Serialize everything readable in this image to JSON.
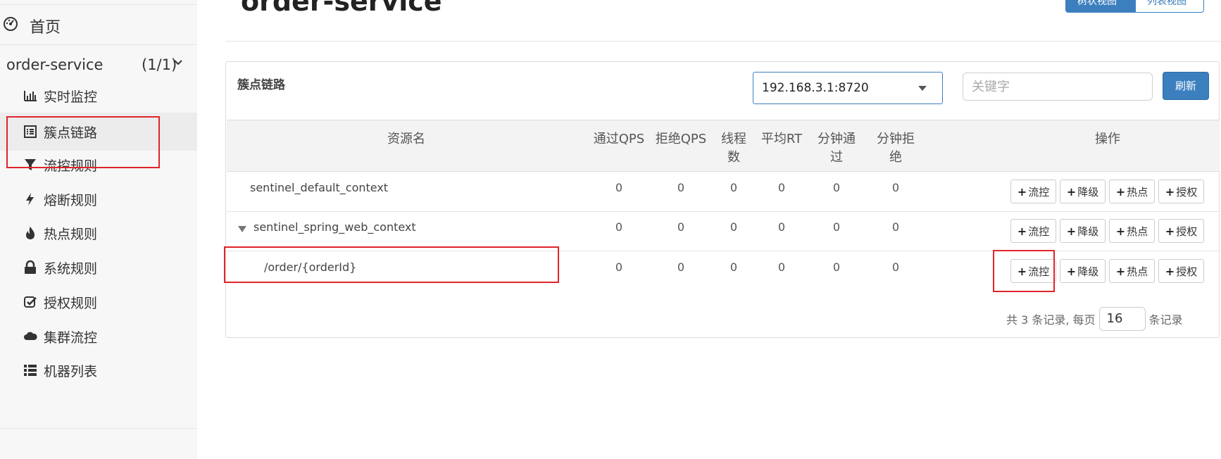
{
  "header": {
    "title": "order-service",
    "view_toggle": {
      "active": "树状视图",
      "inactive": "列表视图"
    }
  },
  "sidebar": {
    "home": "首页",
    "app": {
      "name": "order-service",
      "count": "(1/1)"
    },
    "items": [
      {
        "label": "实时监控",
        "icon": "bar-chart-icon"
      },
      {
        "label": "簇点链路",
        "icon": "list-alt-icon"
      },
      {
        "label": "流控规则",
        "icon": "filter-icon"
      },
      {
        "label": "熔断规则",
        "icon": "flash-icon"
      },
      {
        "label": "热点规则",
        "icon": "fire-icon"
      },
      {
        "label": "系统规则",
        "icon": "lock-icon"
      },
      {
        "label": "授权规则",
        "icon": "check-icon"
      },
      {
        "label": "集群流控",
        "icon": "cloud-icon"
      },
      {
        "label": "机器列表",
        "icon": "th-list-icon"
      }
    ]
  },
  "panel": {
    "title": "簇点链路",
    "machine": "192.168.3.1:8720",
    "keyword_placeholder": "关键字",
    "refresh": "刷新",
    "columns": {
      "resource": "资源名",
      "pass_qps": "通过QPS",
      "block_qps": "拒绝QPS",
      "threads": "线程\n数",
      "avg_rt": "平均RT",
      "minute_pass": "分钟通\n过",
      "minute_block": "分钟拒\n绝",
      "ops": "操作"
    },
    "rows": [
      {
        "resource": "sentinel_default_context",
        "pass_qps": "0",
        "block_qps": "0",
        "threads": "0",
        "avg_rt": "0",
        "minute_pass": "0",
        "minute_block": "0"
      },
      {
        "resource": "sentinel_spring_web_context",
        "pass_qps": "0",
        "block_qps": "0",
        "threads": "0",
        "avg_rt": "0",
        "minute_pass": "0",
        "minute_block": "0"
      },
      {
        "resource": "/order/{orderId}",
        "pass_qps": "0",
        "block_qps": "0",
        "threads": "0",
        "avg_rt": "0",
        "minute_pass": "0",
        "minute_block": "0"
      }
    ],
    "actions": {
      "flow": "流控",
      "degrade": "降级",
      "hotspot": "热点",
      "auth": "授权"
    },
    "pager": {
      "prefix": "共 3 条记录, 每页",
      "page_size": "16",
      "suffix": "条记录"
    }
  },
  "colors": {
    "accent": "#3c7fbf",
    "highlight": "#e0242b"
  }
}
